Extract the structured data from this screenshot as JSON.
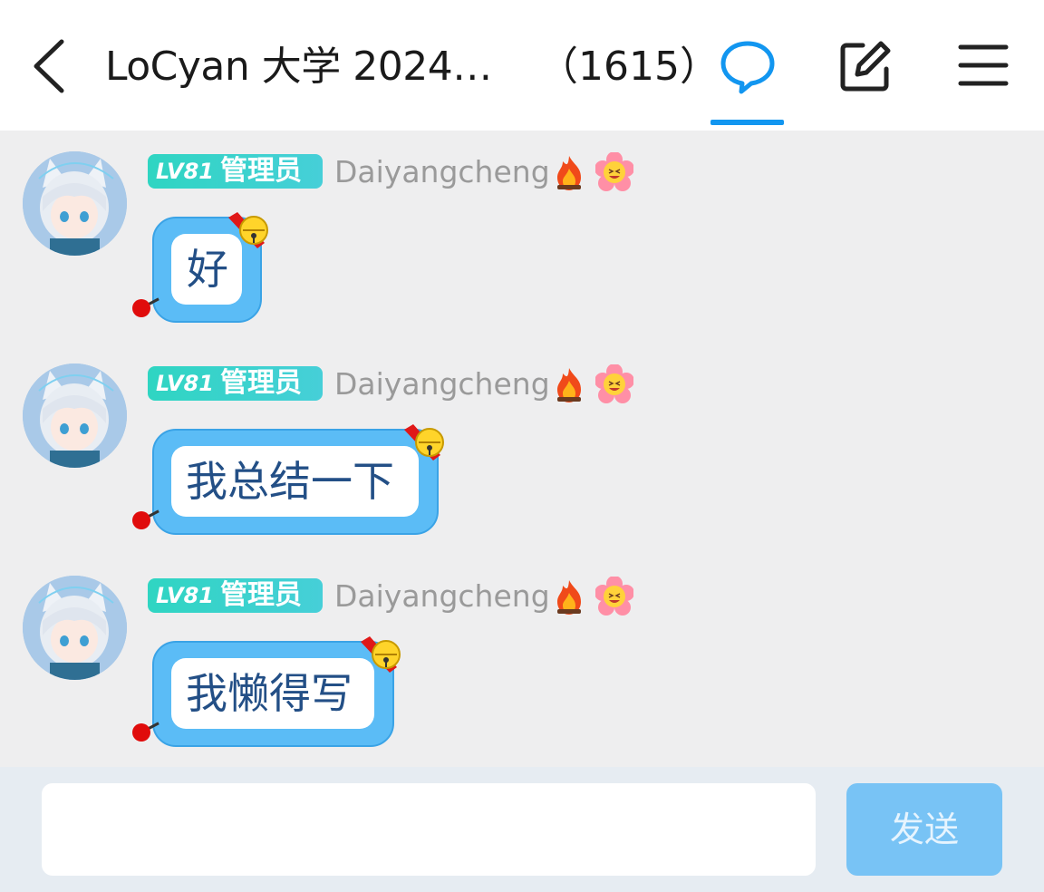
{
  "header": {
    "title": "LoCyan 大学 2024…",
    "member_count": "（1615）",
    "accent_color": "#1296f0",
    "icons": [
      "chevron-left-icon",
      "chat-bubble-icon",
      "edit-icon",
      "menu-icon"
    ]
  },
  "messages": [
    {
      "level": "LV81",
      "role": "管理员",
      "username": "Daiyangcheng",
      "text": "好"
    },
    {
      "level": "LV81",
      "role": "管理员",
      "username": "Daiyangcheng",
      "text": "我总结一下"
    },
    {
      "level": "LV81",
      "role": "管理员",
      "username": "Daiyangcheng",
      "text": "我懒得写"
    }
  ],
  "composer": {
    "input_value": "",
    "send_label": "发送",
    "send_color": "#78c3f5"
  },
  "colors": {
    "badge": "#2fd5c2",
    "bubble": "#5bbcf6",
    "bubble_text": "#234f86",
    "background": "#eeeeef"
  }
}
